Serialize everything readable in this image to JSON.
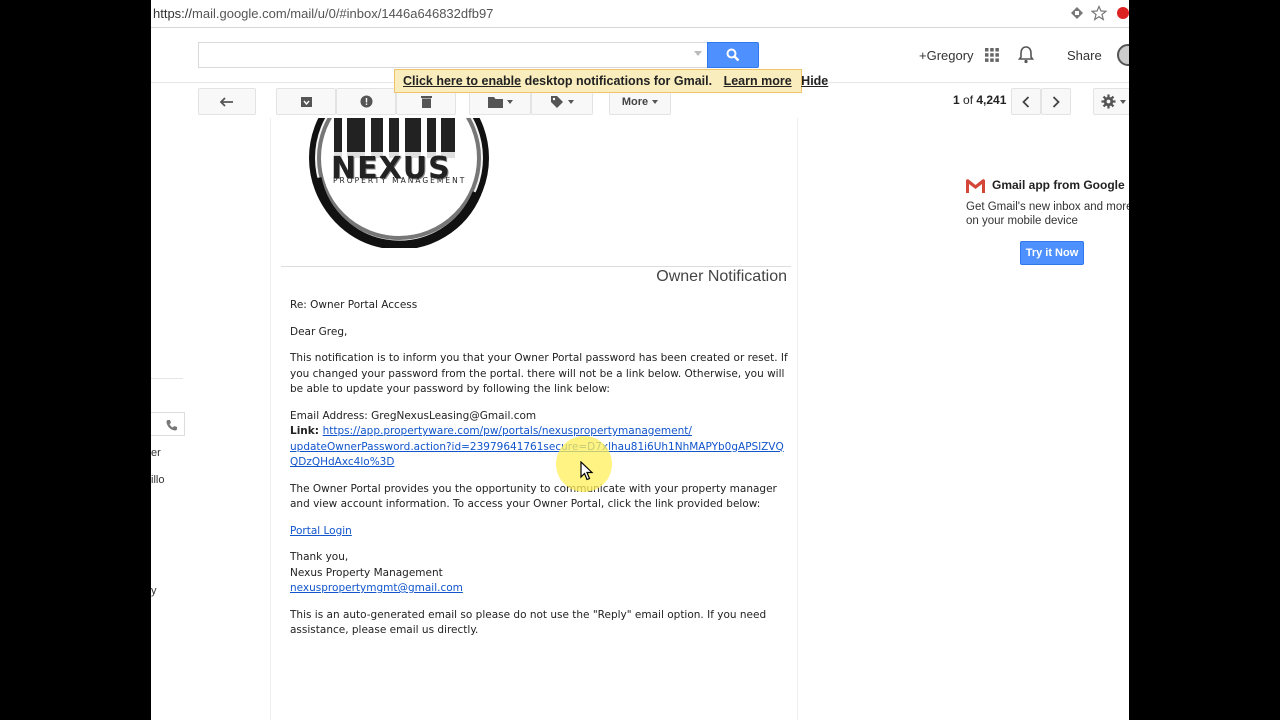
{
  "browser": {
    "url_scheme": "https://",
    "url_rest": "mail.google.com/mail/u/0/#inbox/1446a646832dfb97"
  },
  "header": {
    "search_placeholder": "",
    "user": "+Gregory",
    "share": "Share"
  },
  "notification_bar": {
    "click_here": "Click here to enable",
    "text": " desktop notifications for Gmail.",
    "learn_more": "Learn more",
    "hide": "Hide"
  },
  "toolbar": {
    "more_label": "More",
    "pager_current": "1",
    "pager_of": " of ",
    "pager_total": "4,241"
  },
  "left_fragments": [
    "er",
    "illo",
    "y"
  ],
  "email": {
    "logo_text": "NEXUS",
    "logo_subtext": "PROPERTY MANAGEMENT",
    "heading": "Owner Notification",
    "re_line": "Re: Owner Portal Access",
    "greeting": "Dear Greg,",
    "para1": "This notification is to inform you that your Owner Portal password has been created or reset. If you changed your password from the portal. there will not be a link below. Otherwise, you will be able to update your password by following the link below:",
    "email_label": "Email Address: ",
    "email_value": "GregNexusLeasing@Gmail.com",
    "link_label": "Link: ",
    "link_line1": "https://app.propertyware.com/pw/portals/nexuspropertymanagement/",
    "link_line2": "updateOwnerPassword.action?id=23979641761secure=D7xlhau81i6Uh1NhMAPYb0gAPSlZVQ",
    "link_line3": "QDzQHdAxc4lo%3D",
    "para2": "The Owner Portal provides you the opportunity to communicate with your property manager and view account information. To access your Owner Portal, click the link provided below:",
    "portal_login": "Portal Login",
    "thanks": "Thank you,",
    "company": "Nexus Property Management",
    "contact_email": "nexuspropertymgmt@gmail.com",
    "para3": "This is an auto-generated email so please do not use the \"Reply\" email option. If you need assistance, please email us directly."
  },
  "right_ad": {
    "title": "Gmail app from Google",
    "desc": "Get Gmail's new inbox and more on your mobile device",
    "button": "Try it Now"
  },
  "colors": {
    "accent": "#4d90fe",
    "link": "#1155cc",
    "notify_bg": "#f9edbe"
  }
}
